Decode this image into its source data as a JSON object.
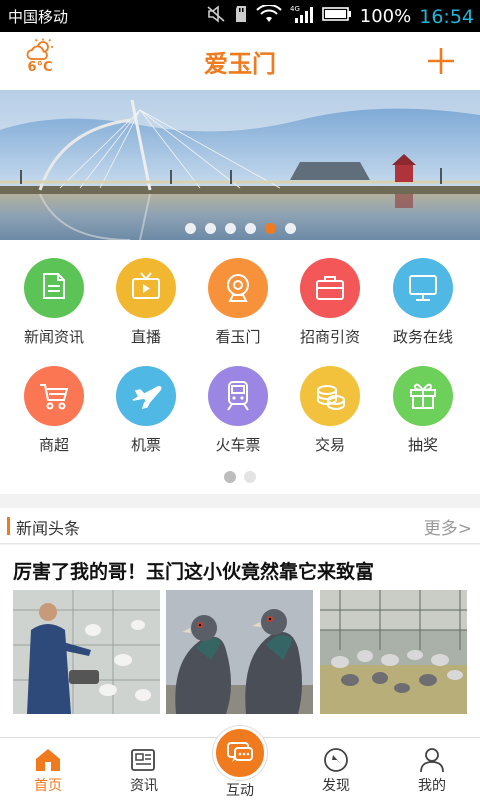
{
  "status_bar": {
    "carrier": "中国移动",
    "network": "4G",
    "battery": "100%",
    "time": "16:54"
  },
  "header": {
    "title": "爱玉门",
    "temperature": "6°C",
    "weather_icon": "partly-cloudy-icon",
    "add_icon": "plus-icon"
  },
  "banner": {
    "slide_count": 6,
    "active_slide": 5
  },
  "grid": {
    "items": [
      {
        "label": "新闻资讯",
        "icon": "document-icon",
        "color": "#5cc456"
      },
      {
        "label": "直播",
        "icon": "tv-icon",
        "color": "#f2b730"
      },
      {
        "label": "看玉门",
        "icon": "webcam-icon",
        "color": "#f7923a"
      },
      {
        "label": "招商引资",
        "icon": "briefcase-icon",
        "color": "#f45757"
      },
      {
        "label": "政务在线",
        "icon": "monitor-icon",
        "color": "#4fb8e4"
      },
      {
        "label": "商超",
        "icon": "cart-icon",
        "color": "#fb7754"
      },
      {
        "label": "机票",
        "icon": "airplane-icon",
        "color": "#4fb8e4"
      },
      {
        "label": "火车票",
        "icon": "train-icon",
        "color": "#9b86e3"
      },
      {
        "label": "交易",
        "icon": "coins-icon",
        "color": "#f2c23c"
      },
      {
        "label": "抽奖",
        "icon": "gift-icon",
        "color": "#6cd05a"
      }
    ],
    "page_count": 2,
    "active_page": 1
  },
  "news": {
    "section_title": "新闻头条",
    "more_label": "更多>",
    "headline": "厉害了我的哥！玉门这小伙竟然靠它来致富"
  },
  "bottom_nav": {
    "items": [
      {
        "label": "首页",
        "icon": "home-icon",
        "active": true
      },
      {
        "label": "资讯",
        "icon": "news-icon",
        "active": false
      },
      {
        "label": "互动",
        "icon": "chat-icon",
        "active": false
      },
      {
        "label": "发现",
        "icon": "compass-icon",
        "active": false
      },
      {
        "label": "我的",
        "icon": "user-icon",
        "active": false
      }
    ]
  },
  "colors": {
    "accent": "#f07a1e",
    "time": "#1fb6d8"
  }
}
